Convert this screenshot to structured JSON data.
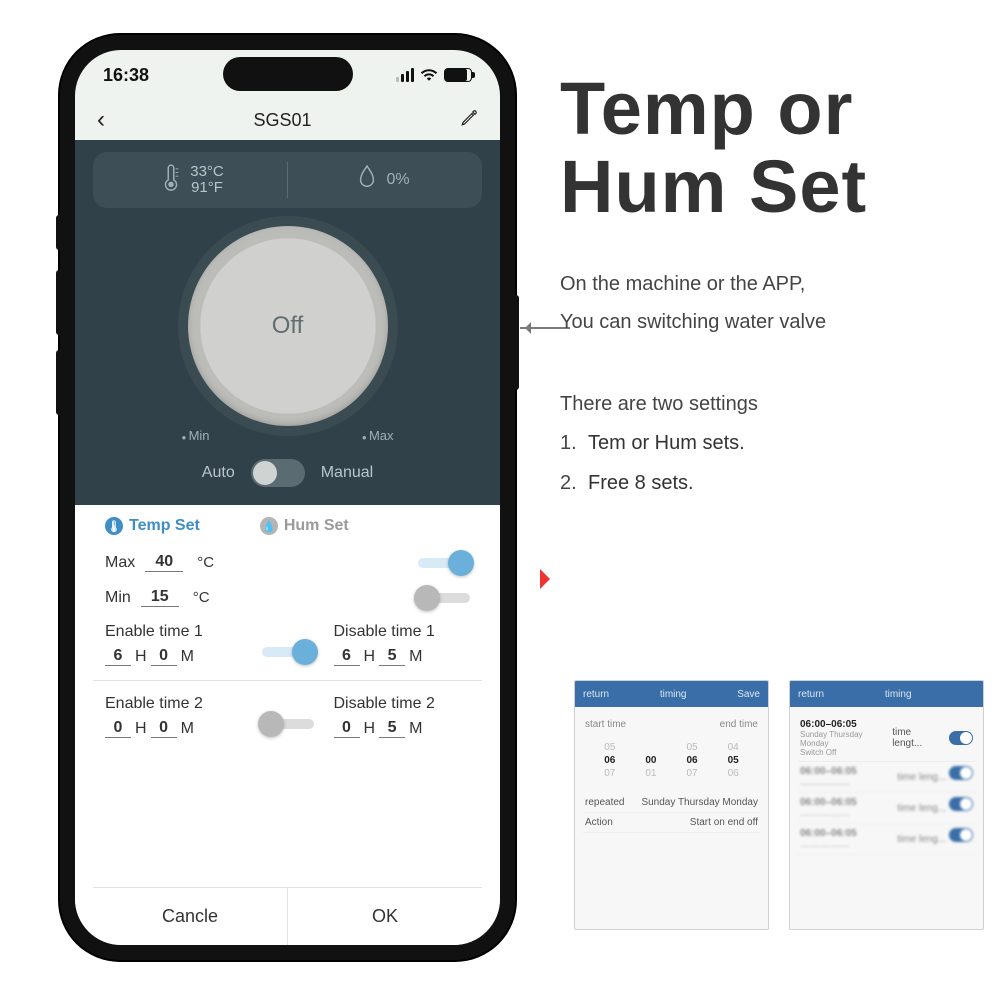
{
  "statusbar": {
    "time": "16:38"
  },
  "header": {
    "title": "SGS01"
  },
  "sensor": {
    "temp_c": "33°C",
    "temp_f": "91°F",
    "humidity": "0%"
  },
  "dial": {
    "state": "Off",
    "min_label": "Min",
    "max_label": "Max"
  },
  "mode": {
    "auto": "Auto",
    "manual": "Manual"
  },
  "tabs": {
    "temp": "Temp Set",
    "hum": "Hum Set"
  },
  "tempset": {
    "max_label": "Max",
    "max_value": "40",
    "max_unit": "°C",
    "min_label": "Min",
    "min_value": "15",
    "min_unit": "°C"
  },
  "times": {
    "enable1_label": "Enable time 1",
    "disable1_label": "Disable time 1",
    "enable1_h": "6",
    "enable1_m": "0",
    "disable1_h": "6",
    "disable1_m": "5",
    "enable2_label": "Enable time 2",
    "disable2_label": "Disable time 2",
    "enable2_h": "0",
    "enable2_m": "0",
    "disable2_h": "0",
    "disable2_m": "5",
    "h": "H",
    "m": "M"
  },
  "buttons": {
    "cancel": "Cancle",
    "ok": "OK"
  },
  "promo": {
    "title_l1": "Temp or",
    "title_l2": "Hum Set",
    "p1": "On the machine or the APP,",
    "p2": "You can switching water valve",
    "p3": "There are two settings",
    "li1": "Tem or Hum sets.",
    "li2": "Free 8 sets."
  },
  "thumb1": {
    "return": "return",
    "title": "timing",
    "save": "Save",
    "start": "start time",
    "end": "end time",
    "repeated": "repeated",
    "repeated_v": "Sunday Thursday Monday",
    "action": "Action",
    "action_v": "Start on end off"
  },
  "thumb2": {
    "return": "return",
    "title": "timing",
    "row1_time": "06:00–06:05",
    "row1_sub": "Sunday Thursday Monday",
    "row1_sub2": "Switch Off",
    "row1_right": "time lengt..."
  }
}
